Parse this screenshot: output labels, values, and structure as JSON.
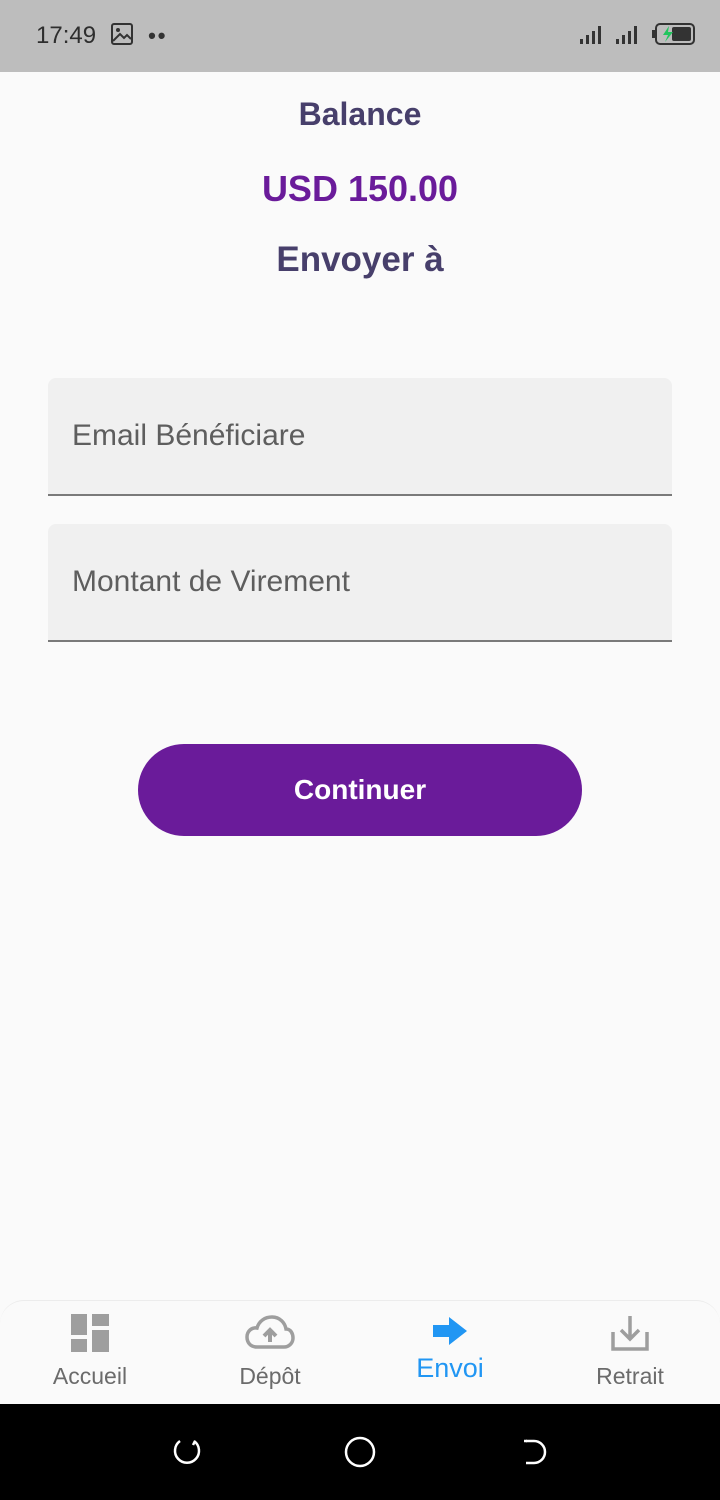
{
  "status_bar": {
    "time": "17:49",
    "icons": [
      "image-icon",
      "dots-icon",
      "signal-icon",
      "signal-icon",
      "battery-charging-icon"
    ]
  },
  "main": {
    "balance_label": "Balance",
    "balance_amount": "USD 150.00",
    "send_to_label": "Envoyer à",
    "email_field": {
      "placeholder": "Email Bénéficiare",
      "value": ""
    },
    "amount_field": {
      "placeholder": "Montant de Virement",
      "value": ""
    },
    "continue_label": "Continuer"
  },
  "bottom_nav": {
    "items": [
      {
        "label": "Accueil",
        "icon": "dashboard-icon",
        "active": false
      },
      {
        "label": "Dépôt",
        "icon": "cloud-upload-icon",
        "active": false
      },
      {
        "label": "Envoi",
        "icon": "arrow-right-icon",
        "active": true
      },
      {
        "label": "Retrait",
        "icon": "download-icon",
        "active": false
      }
    ]
  },
  "system_nav": {
    "buttons": [
      "recents-icon",
      "home-icon",
      "back-icon"
    ]
  },
  "colors": {
    "primary": "#6a1b9a",
    "heading": "#473f6b",
    "active_nav": "#2196f3",
    "inactive_nav": "#9e9e9e"
  }
}
